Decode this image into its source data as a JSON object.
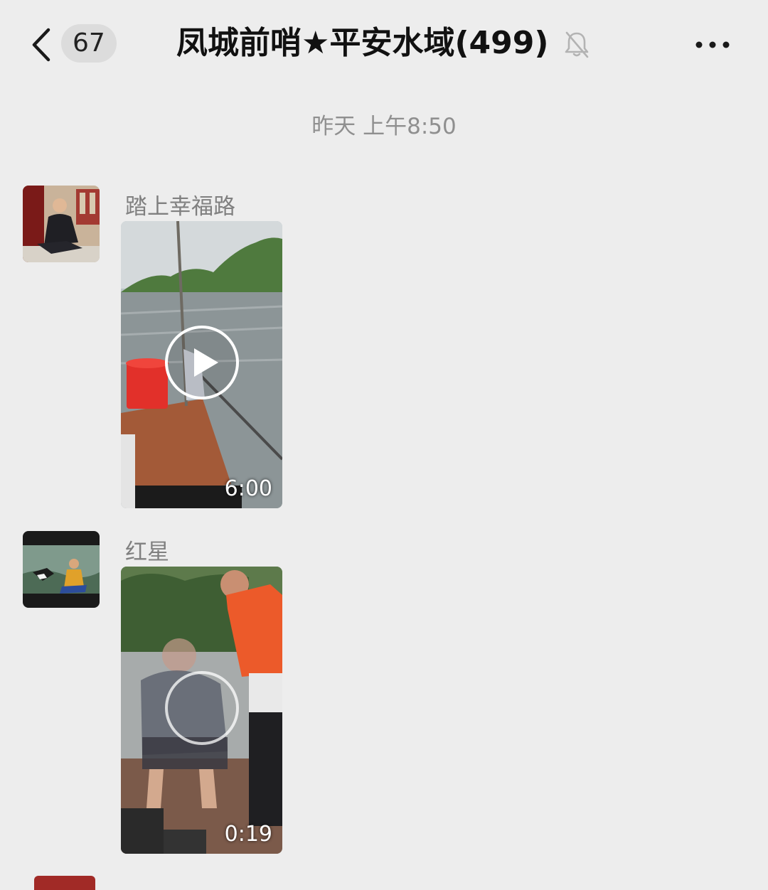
{
  "header": {
    "back_icon": "chevron-left-icon",
    "unread_count": "67",
    "title": "凤城前哨★平安水域(499)",
    "mute_icon": "bell-off-icon",
    "more_icon": "ellipsis-icon"
  },
  "chat": {
    "timestamp": "昨天 上午8:50",
    "messages": [
      {
        "sender": "踏上幸福路",
        "type": "video",
        "duration": "6:00"
      },
      {
        "sender": "红星",
        "type": "video",
        "duration": "0:19"
      }
    ]
  },
  "colors": {
    "background": "#ededed",
    "badge": "#dcdcdc",
    "secondary_text": "#808080"
  }
}
